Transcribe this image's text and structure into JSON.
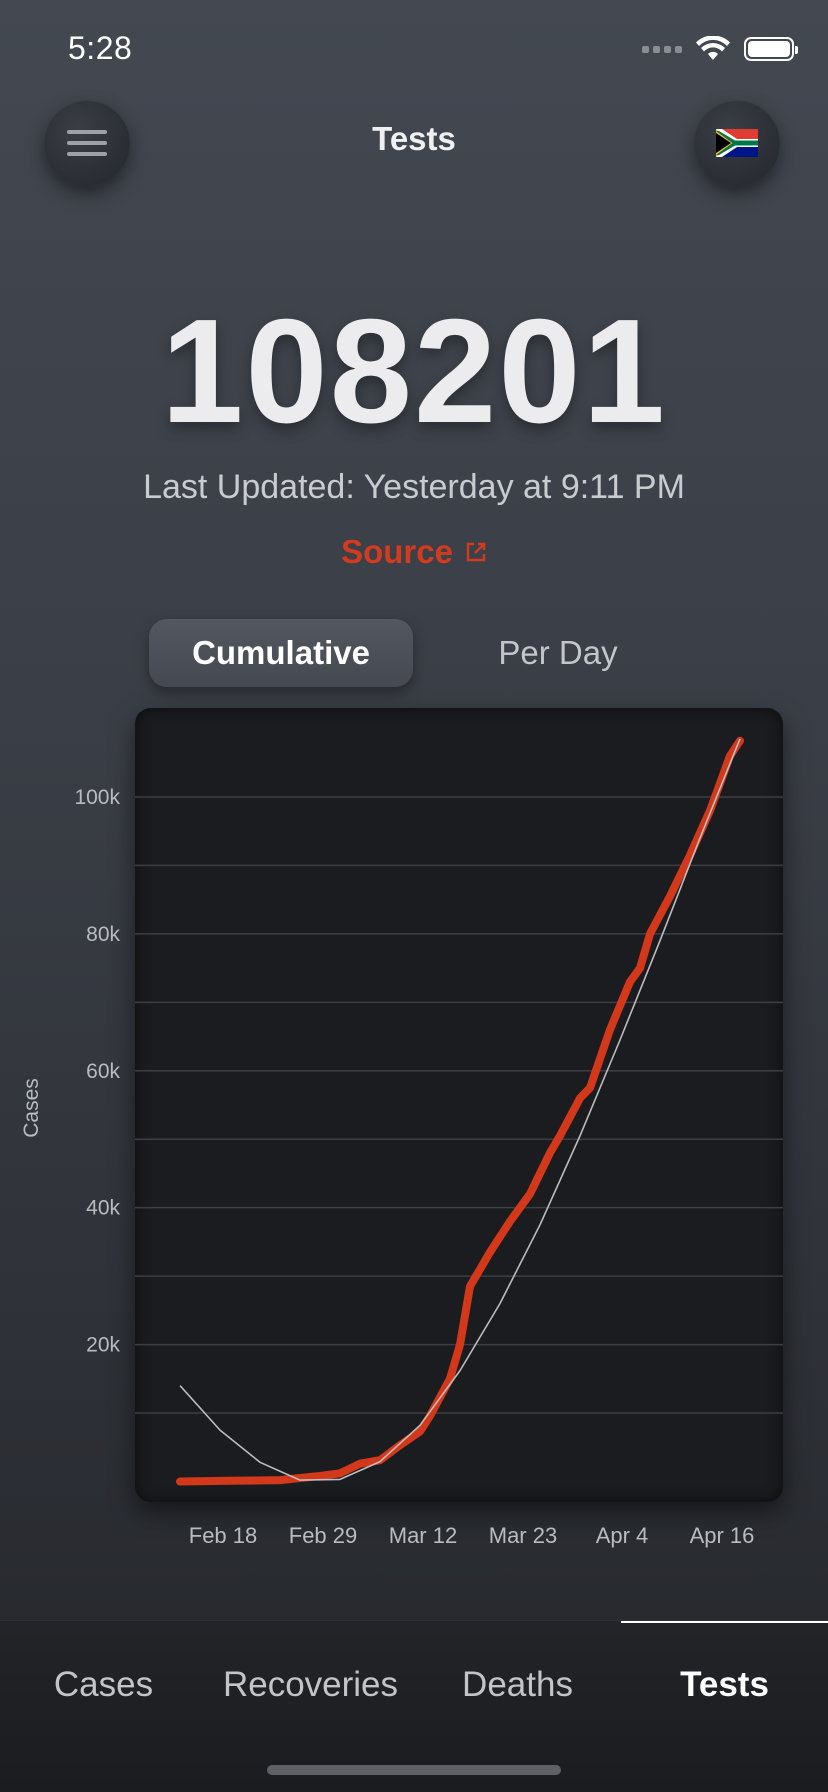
{
  "status_bar": {
    "time": "5:28"
  },
  "header": {
    "title": "Tests",
    "menu_icon": "hamburger-menu-icon",
    "flag_icon": "south-africa-flag-icon"
  },
  "summary": {
    "total": "108201",
    "last_updated": "Last Updated: Yesterday at 9:11 PM",
    "source_label": "Source"
  },
  "toggle": {
    "options": [
      "Cumulative",
      "Per Day"
    ],
    "selected": "Cumulative"
  },
  "chart_data": {
    "type": "line",
    "ylabel": "Cases",
    "ylim": [
      -3000,
      113000
    ],
    "y_ticks": [
      20000,
      40000,
      60000,
      80000,
      100000
    ],
    "y_tick_labels": [
      "20k",
      "40k",
      "60k",
      "80k",
      "100k"
    ],
    "x_tick_labels": [
      "Feb 18",
      "Feb 29",
      "Mar 12",
      "Mar 23",
      "Apr 4",
      "Apr 16"
    ],
    "x_tick_days": [
      0,
      11,
      22,
      33,
      45,
      57
    ],
    "xlim": [
      -5,
      60
    ],
    "grid": true,
    "series": [
      {
        "style": "actual",
        "color": "#d4381a",
        "points": [
          [
            0,
            0
          ],
          [
            5,
            100
          ],
          [
            10,
            200
          ],
          [
            12,
            500
          ],
          [
            14,
            800
          ],
          [
            16,
            1200
          ],
          [
            18,
            2600
          ],
          [
            20,
            3100
          ],
          [
            22,
            5300
          ],
          [
            24,
            7300
          ],
          [
            25,
            9600
          ],
          [
            27,
            15000
          ],
          [
            28,
            20000
          ],
          [
            29,
            28500
          ],
          [
            31,
            33500
          ],
          [
            33,
            38000
          ],
          [
            35,
            42000
          ],
          [
            37,
            48000
          ],
          [
            38,
            50500
          ],
          [
            40,
            56000
          ],
          [
            41,
            57500
          ],
          [
            43,
            66000
          ],
          [
            45,
            73000
          ],
          [
            46,
            75000
          ],
          [
            47,
            80000
          ],
          [
            49,
            85500
          ],
          [
            51,
            91500
          ],
          [
            53,
            98000
          ],
          [
            55,
            106000
          ],
          [
            56,
            108201
          ]
        ]
      },
      {
        "style": "trend",
        "color": "#bdbdc0",
        "points": [
          [
            0,
            14000
          ],
          [
            4,
            7500
          ],
          [
            8,
            2800
          ],
          [
            12,
            200
          ],
          [
            16,
            300
          ],
          [
            20,
            2900
          ],
          [
            24,
            8200
          ],
          [
            28,
            16200
          ],
          [
            32,
            26000
          ],
          [
            36,
            37500
          ],
          [
            40,
            50500
          ],
          [
            44,
            64500
          ],
          [
            48,
            79000
          ],
          [
            52,
            94000
          ],
          [
            56,
            108500
          ]
        ]
      }
    ]
  },
  "tabs": {
    "items": [
      "Cases",
      "Recoveries",
      "Deaths",
      "Tests"
    ],
    "active": "Tests"
  },
  "colors": {
    "accent": "#d33a1e",
    "background": "#3a3e46"
  }
}
